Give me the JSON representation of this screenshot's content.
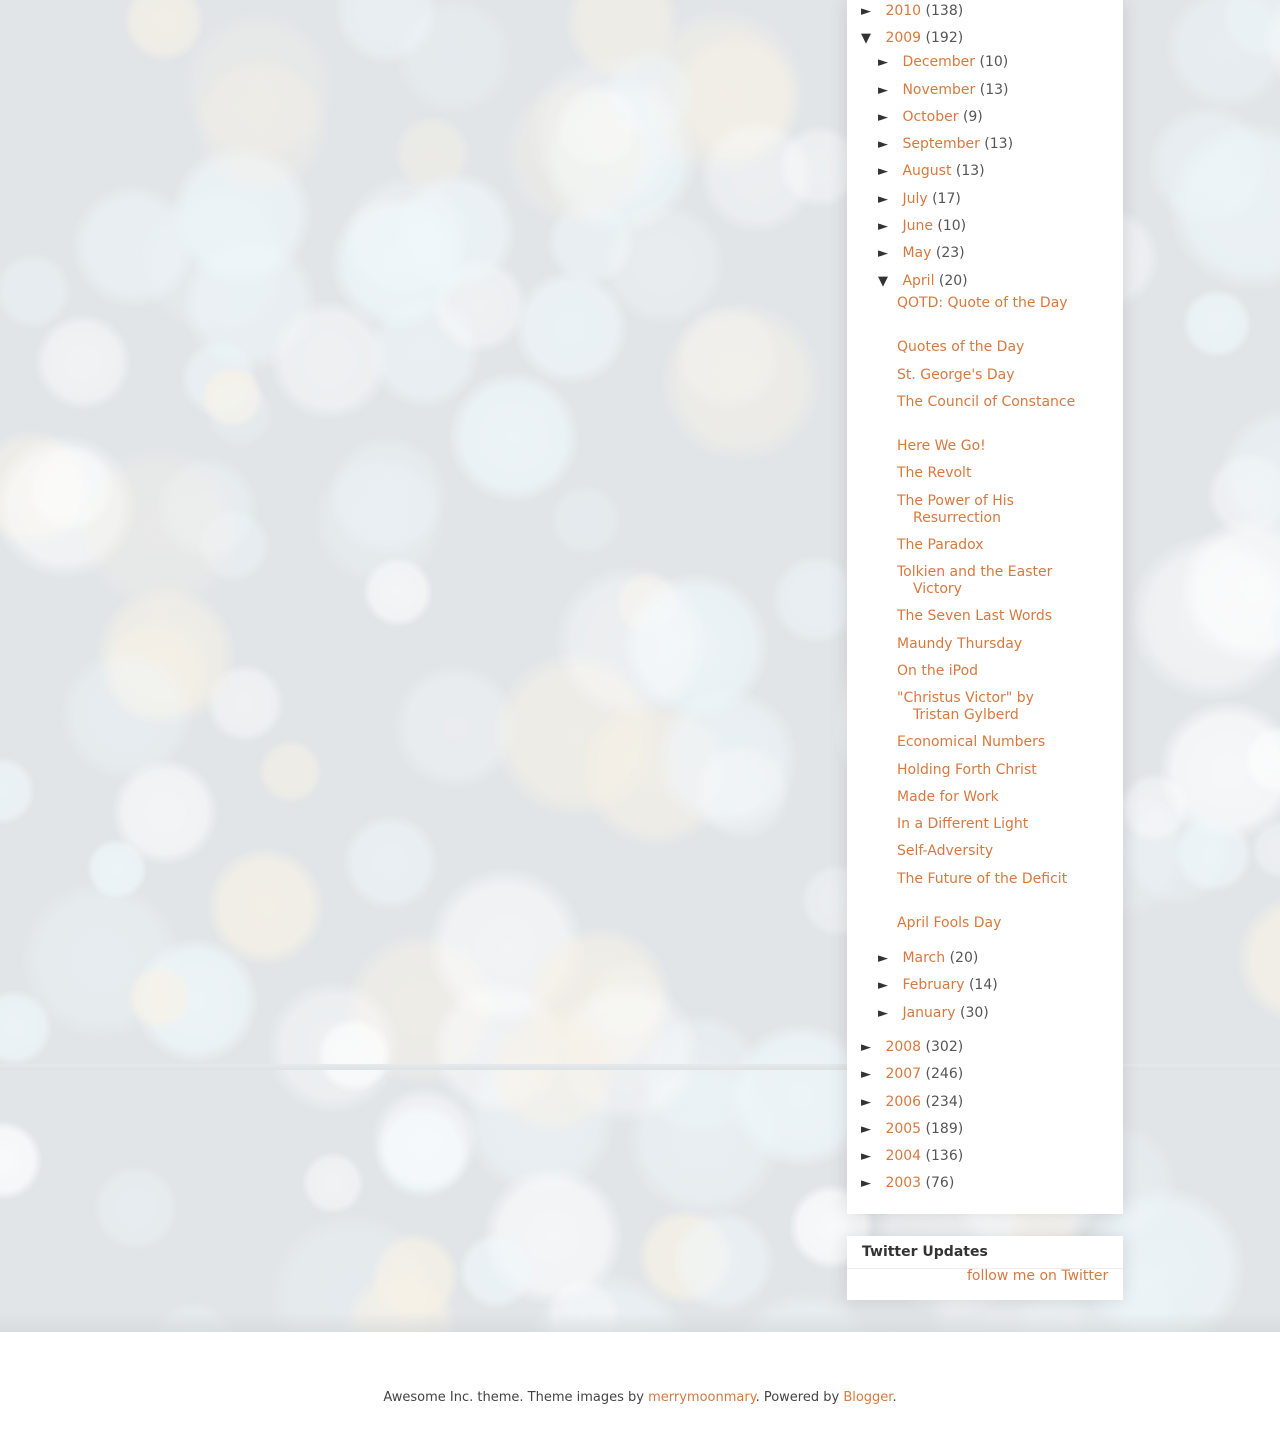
{
  "archive": {
    "years": [
      {
        "year": "2010",
        "count": "(138)",
        "toggle": "►"
      },
      {
        "year": "2009",
        "count": "(192)",
        "toggle": "▼"
      },
      {
        "year": "2008",
        "count": "(302)",
        "toggle": "►"
      },
      {
        "year": "2007",
        "count": "(246)",
        "toggle": "►"
      },
      {
        "year": "2006",
        "count": "(234)",
        "toggle": "►"
      },
      {
        "year": "2005",
        "count": "(189)",
        "toggle": "►"
      },
      {
        "year": "2004",
        "count": "(136)",
        "toggle": "►"
      },
      {
        "year": "2003",
        "count": "(76)",
        "toggle": "►"
      }
    ],
    "months_2009": [
      {
        "month": "December",
        "count": "(10)",
        "toggle": "►"
      },
      {
        "month": "November",
        "count": "(13)",
        "toggle": "►"
      },
      {
        "month": "October",
        "count": "(9)",
        "toggle": "►"
      },
      {
        "month": "September",
        "count": "(13)",
        "toggle": "►"
      },
      {
        "month": "August",
        "count": "(13)",
        "toggle": "►"
      },
      {
        "month": "July",
        "count": "(17)",
        "toggle": "►"
      },
      {
        "month": "June",
        "count": "(10)",
        "toggle": "►"
      },
      {
        "month": "May",
        "count": "(23)",
        "toggle": "►"
      },
      {
        "month": "April",
        "count": "(20)",
        "toggle": "▼"
      },
      {
        "month": "March",
        "count": "(20)",
        "toggle": "►"
      },
      {
        "month": "February",
        "count": "(14)",
        "toggle": "►"
      },
      {
        "month": "January",
        "count": "(30)",
        "toggle": "►"
      }
    ],
    "april_posts": [
      "QOTD: Quote of the Day",
      "Quotes of the Day",
      "St. George's Day",
      "The Council of Constance",
      "Here We Go!",
      "The Revolt",
      "The Power of His Resurrection",
      "The Paradox",
      "Tolkien and the Easter Victory",
      "The Seven Last Words",
      "Maundy Thursday",
      "On the iPod",
      "\"Christus Victor\" by Tristan Gylberd",
      "Economical Numbers",
      "Holding Forth Christ",
      "Made for Work",
      "In a Different Light",
      "Self-Adversity",
      "The Future of the Deficit",
      "April Fools Day"
    ]
  },
  "twitter": {
    "title": "Twitter Updates",
    "follow_label": "follow me on Twitter"
  },
  "footer": {
    "text1": "Awesome Inc. theme. Theme images by ",
    "link1": "merrymoonmary",
    "text2": ". Powered by ",
    "link2": "Blogger",
    "text3": "."
  },
  "colors": {
    "link": "#d7793f",
    "text": "#555555",
    "panel_bg": "#ffffff"
  }
}
